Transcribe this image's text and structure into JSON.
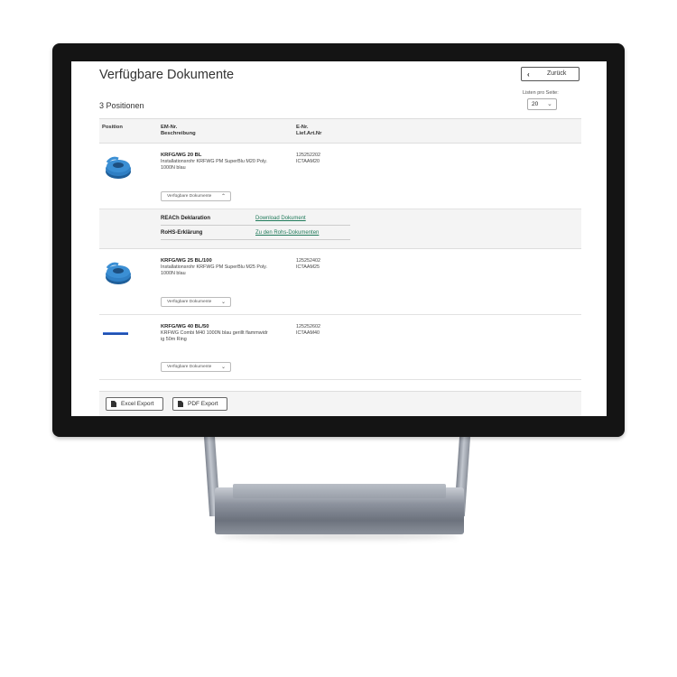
{
  "page": {
    "title": "Verfügbare Dokumente",
    "back_label": "Zurück",
    "per_page_label": "Listen pro Seite:",
    "per_page_value": "20",
    "count_text": "3 Positionen"
  },
  "table": {
    "headers": {
      "position": "Position",
      "em_nr": "EM-Nr.",
      "beschreibung": "Beschreibung",
      "e_nr": "E-Nr.",
      "lief_art_nr": "Lief.Art.Nr"
    },
    "items": [
      {
        "name": "KRFG/WG 20 BL",
        "desc_line1": "Installationsrohr KRFWG PM SuperBlu M20 Poly.",
        "desc_line2": "1000N blau",
        "e_nr": "125252202",
        "lief_nr": "ICTAAM20",
        "docs_button": "Verfügbare Dokumente",
        "expanded": true
      },
      {
        "name": "KRFG/WG 25 BL/100",
        "desc_line1": "Installationsrohr KRFWG PM SuperBlu M25 Poly.",
        "desc_line2": "1000N blau",
        "e_nr": "125252402",
        "lief_nr": "ICTAAM25",
        "docs_button": "Verfügbare Dokumente",
        "expanded": false
      },
      {
        "name": "KRFG/WG 40 BL/50",
        "desc_line1": "KRFWG Combi M40 1000N blau gerillt flammwidr",
        "desc_line2": "ig 50m Ring",
        "e_nr": "125252602",
        "lief_nr": "ICTAAM40",
        "docs_button": "Verfügbare Dokumente",
        "expanded": false
      }
    ],
    "documents": [
      {
        "name": "REACh Deklaration",
        "link": "Download Dokument"
      },
      {
        "name": "RoHS-Erklärung",
        "link": "Zu den Rohs-Dokumenten"
      }
    ]
  },
  "footer": {
    "excel_label": "Excel Export",
    "pdf_label": "PDF Export"
  },
  "colors": {
    "link": "#1f7a5a",
    "product_blue": "#2f7fc4",
    "bezel": "#141414"
  }
}
